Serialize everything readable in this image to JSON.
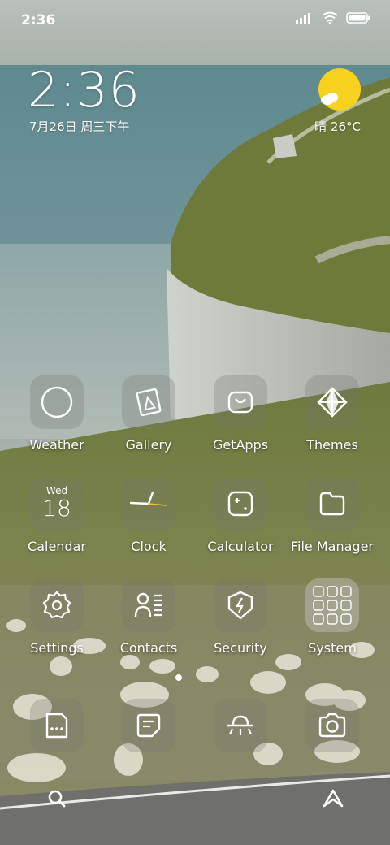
{
  "status_bar": {
    "time": "2:36",
    "signal_icon": "signal-bars-icon",
    "wifi_icon": "wifi-icon",
    "battery_icon": "battery-icon"
  },
  "clock_widget": {
    "time": "2:36",
    "date": "7月26日 周三下午"
  },
  "weather_widget": {
    "icon": "partly-sunny-icon",
    "text": "晴 26°C",
    "sun_color": "#f6d21e"
  },
  "apps": [
    {
      "label": "Weather",
      "icon": "circle-icon"
    },
    {
      "label": "Gallery",
      "icon": "picture-frame-icon"
    },
    {
      "label": "GetApps",
      "icon": "shopping-bag-icon"
    },
    {
      "label": "Themes",
      "icon": "diamond-star-icon"
    },
    {
      "label": "Calendar",
      "icon": "calendar-icon",
      "day": "Wed",
      "date": "18"
    },
    {
      "label": "Clock",
      "icon": "clock-hands-icon"
    },
    {
      "label": "Calculator",
      "icon": "calculator-icon"
    },
    {
      "label": "File Manager",
      "icon": "folder-icon"
    },
    {
      "label": "Settings",
      "icon": "gear-icon"
    },
    {
      "label": "Contacts",
      "icon": "contacts-icon"
    },
    {
      "label": "Security",
      "icon": "shield-bolt-icon"
    },
    {
      "label": "System",
      "icon": "app-folder-icon"
    }
  ],
  "dock": [
    {
      "icon": "messages-icon"
    },
    {
      "icon": "notes-icon"
    },
    {
      "icon": "browser-ufo-icon"
    },
    {
      "icon": "camera-icon"
    }
  ],
  "bottom": {
    "search_icon": "search-icon",
    "assistant_icon": "assistant-icon"
  }
}
